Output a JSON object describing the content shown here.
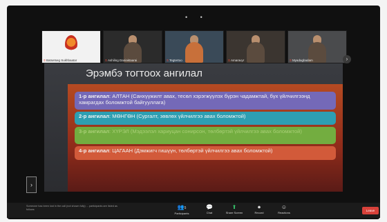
{
  "participants": [
    {
      "name": "Batsetseg Sukhbaatar"
    },
    {
      "name": "Ashiling Daniaktaarai"
    },
    {
      "name": "Tegtertoo"
    },
    {
      "name": "Amaravyr"
    },
    {
      "name": "Myadagbadam"
    }
  ],
  "slide": {
    "title": "Эрэмбэ тогтоох ангилал",
    "categories": [
      {
        "label": "1-р ангилал",
        "text": "АЛТАН (Санхүүжилт авах, тесөл хэрэгжүүлэх бүрэн чадамжтай, бүх үйлчилгээнд хамрагдах боломжтой байгууллага)"
      },
      {
        "label": "2-р ангилал",
        "text": "МӨНГӨН (Сургалт, зөвлөх үйлчилгээ авах боломжтой)"
      },
      {
        "label": "3-р ангилал",
        "text": "ХҮРЭЛ (Мэдээлэл хариуцан сонирсон, төлбөртэй үйлчилгээ авах боломжтой)"
      },
      {
        "label": "4-р ангилал",
        "text": "ЦАГААН (Дэмжигч гишүүн, төлбөртэй үйлчилгээ авах боломжтой)"
      }
    ]
  },
  "toolbar": {
    "notice": "Someone has been lost in the call (not shown fully) ... participants are listed as follows",
    "participants": {
      "label": "Participants",
      "count": "5"
    },
    "chat": {
      "label": "Chat"
    },
    "share": {
      "label": "Share Screen"
    },
    "record": {
      "label": "Record"
    },
    "reactions": {
      "label": "Reactions"
    },
    "end": {
      "label": "Leave"
    }
  },
  "colors": {
    "panel": "#b54a22",
    "cat1": "#7469b8",
    "cat2": "#2d9fb2",
    "cat3": "#73ad40",
    "cat4": "#d25a3a",
    "end": "#d8413a"
  }
}
